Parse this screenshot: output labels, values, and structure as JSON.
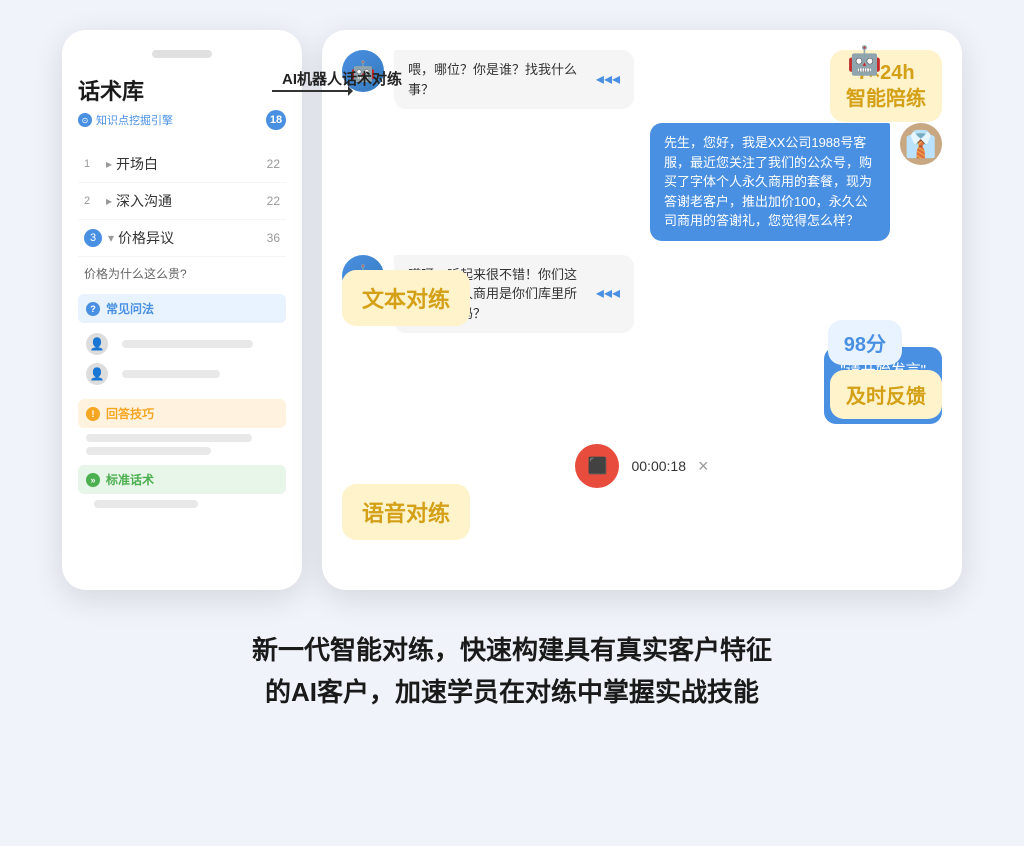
{
  "page": {
    "bg_color": "#f0f4fa"
  },
  "left_panel": {
    "title": "话术库",
    "subtitle": "知识点挖掘引擎",
    "badge": "18",
    "menu_items": [
      {
        "num": "1",
        "label": "开场白",
        "count": "22",
        "active": false
      },
      {
        "num": "2",
        "label": "深入沟通",
        "count": "22",
        "active": false
      },
      {
        "num": "3",
        "label": "价格异议",
        "count": "36",
        "active": true
      }
    ],
    "sub_question": "价格为什么这么贵?",
    "sections": [
      {
        "type": "blue",
        "icon": "?",
        "label": "常见问法"
      },
      {
        "type": "orange",
        "icon": "!",
        "label": "回答技巧"
      },
      {
        "type": "green",
        "icon": "»",
        "label": "标准话术"
      }
    ]
  },
  "connector": {
    "label": "AI机器人话术对练"
  },
  "chat": {
    "messages": [
      {
        "side": "left",
        "avatar": "🤖",
        "text": "喂，哪位？你是谁？找我什么事？",
        "has_sound": true
      },
      {
        "side": "right",
        "avatar": "👤",
        "text": "先生，您好，我是XX公司1988号客服，最近您关注了我们的公众号，购买了字体个人永久商用的套餐，现为答谢老客户，推出加价100，永久公司商用的答谢礼，您觉得怎么样？",
        "has_sound": false
      },
      {
        "side": "left",
        "avatar": "🤖",
        "text": "哎呀，听起来很不错！你们这个公司永久商用是你们库里所有的字体吗？",
        "has_sound": true
      }
    ],
    "voice_bubble": {
      "title": "\"请开始发言\"",
      "waveform_bars": [
        8,
        14,
        20,
        16,
        24,
        18,
        12,
        22,
        16,
        10,
        18,
        14
      ]
    },
    "voice_controls": {
      "timer": "00:00:18",
      "close_label": "×"
    }
  },
  "float_labels": {
    "top_right": "7×24h\n智能陪练",
    "text_practice": "文本对练",
    "score": "98分",
    "feedback": "及时反馈",
    "voice_practice": "语音对练"
  },
  "bottom": {
    "line1": "新一代智能对练，快速构建具有真实客户特征",
    "line2": "的AI客户，加速学员在对练中掌握实战技能"
  }
}
